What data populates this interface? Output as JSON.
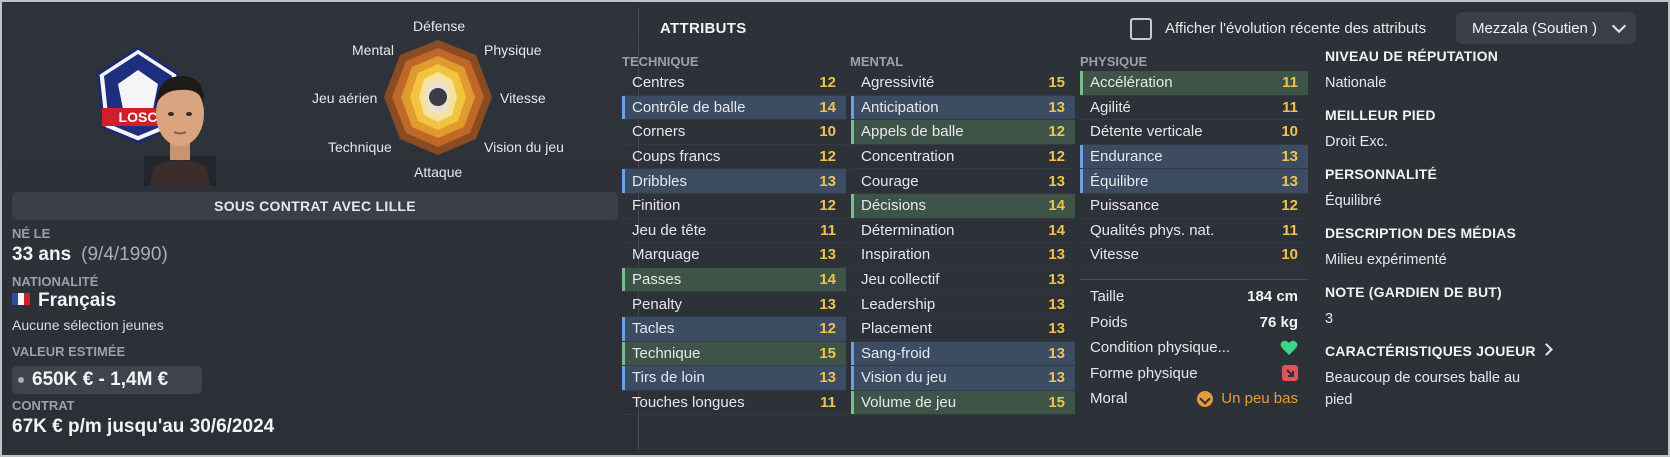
{
  "radar": {
    "labels": {
      "top": "Défense",
      "top_right": "Physique",
      "right": "Vitesse",
      "bottom_right": "Vision du jeu",
      "bottom": "Attaque",
      "bottom_left": "Technique",
      "left": "Jeu aérien",
      "top_left": "Mental"
    }
  },
  "club_logo": {
    "text": "LOSC"
  },
  "contract_banner": "SOUS CONTRAT AVEC LILLE",
  "born": {
    "label": "NÉ LE",
    "age": "33 ans",
    "date": "(9/4/1990)"
  },
  "nationality": {
    "label": "NATIONALITÉ",
    "value": "Français",
    "note": "Aucune sélection jeunes"
  },
  "estimated_value": {
    "label": "VALEUR ESTIMÉE",
    "value": "650K € - 1,4M €"
  },
  "contract": {
    "label": "CONTRAT",
    "value": "67K € p/m jusqu'au 30/6/2024"
  },
  "attributes": {
    "title": "ATTRIBUTS",
    "checkbox_label": "Afficher l'évolution récente des attributs",
    "role": "Mezzala (Soutien )",
    "technique_header": "TECHNIQUE",
    "mental_header": "MENTAL",
    "physique_header": "PHYSIQUE",
    "technique": [
      {
        "name": "Centres",
        "value": "12",
        "hl": ""
      },
      {
        "name": "Contrôle de balle",
        "value": "14",
        "hl": "blue"
      },
      {
        "name": "Corners",
        "value": "10",
        "hl": ""
      },
      {
        "name": "Coups francs",
        "value": "12",
        "hl": ""
      },
      {
        "name": "Dribbles",
        "value": "13",
        "hl": "blue"
      },
      {
        "name": "Finition",
        "value": "12",
        "hl": ""
      },
      {
        "name": "Jeu de tête",
        "value": "11",
        "hl": ""
      },
      {
        "name": "Marquage",
        "value": "13",
        "hl": ""
      },
      {
        "name": "Passes",
        "value": "14",
        "hl": "green"
      },
      {
        "name": "Penalty",
        "value": "13",
        "hl": ""
      },
      {
        "name": "Tacles",
        "value": "12",
        "hl": "blue"
      },
      {
        "name": "Technique",
        "value": "15",
        "hl": "green"
      },
      {
        "name": "Tirs de loin",
        "value": "13",
        "hl": "blue"
      },
      {
        "name": "Touches longues",
        "value": "11",
        "hl": ""
      }
    ],
    "mental": [
      {
        "name": "Agressivité",
        "value": "15",
        "hl": ""
      },
      {
        "name": "Anticipation",
        "value": "13",
        "hl": "blue"
      },
      {
        "name": "Appels de balle",
        "value": "12",
        "hl": "green"
      },
      {
        "name": "Concentration",
        "value": "12",
        "hl": ""
      },
      {
        "name": "Courage",
        "value": "13",
        "hl": ""
      },
      {
        "name": "Décisions",
        "value": "14",
        "hl": "green"
      },
      {
        "name": "Détermination",
        "value": "14",
        "hl": ""
      },
      {
        "name": "Inspiration",
        "value": "13",
        "hl": ""
      },
      {
        "name": "Jeu collectif",
        "value": "13",
        "hl": ""
      },
      {
        "name": "Leadership",
        "value": "13",
        "hl": ""
      },
      {
        "name": "Placement",
        "value": "13",
        "hl": ""
      },
      {
        "name": "Sang-froid",
        "value": "13",
        "hl": "blue"
      },
      {
        "name": "Vision du jeu",
        "value": "13",
        "hl": "blue"
      },
      {
        "name": "Volume de jeu",
        "value": "15",
        "hl": "green"
      }
    ],
    "physique": [
      {
        "name": "Accélération",
        "value": "11",
        "hl": "green"
      },
      {
        "name": "Agilité",
        "value": "11",
        "hl": ""
      },
      {
        "name": "Détente verticale",
        "value": "10",
        "hl": ""
      },
      {
        "name": "Endurance",
        "value": "13",
        "hl": "blue"
      },
      {
        "name": "Équilibre",
        "value": "13",
        "hl": "blue"
      },
      {
        "name": "Puissance",
        "value": "12",
        "hl": ""
      },
      {
        "name": "Qualités phys. nat.",
        "value": "11",
        "hl": ""
      },
      {
        "name": "Vitesse",
        "value": "10",
        "hl": ""
      }
    ],
    "physical_info": {
      "height_label": "Taille",
      "height": "184 cm",
      "weight_label": "Poids",
      "weight": "76 kg",
      "condition_label": "Condition physique...",
      "form_label": "Forme physique",
      "morale_label": "Moral",
      "morale": "Un peu bas"
    }
  },
  "profile": {
    "reputation_label": "NIVEAU DE RÉPUTATION",
    "reputation": "Nationale",
    "foot_label": "MEILLEUR PIED",
    "foot": "Droit Exc.",
    "personality_label": "PERSONNALITÉ",
    "personality": "Équilibré",
    "media_label": "DESCRIPTION DES MÉDIAS",
    "media": "Milieu expérimenté",
    "gk_label": "NOTE (GARDIEN DE BUT)",
    "gk": "3",
    "traits_label": "CARACTÉRISTIQUES JOUEUR",
    "traits": "Beaucoup de courses balle au pied"
  },
  "colors": {
    "attr_value": "#f0c34a",
    "blue_highlight": "#3b4c63",
    "green_highlight": "#3f5448",
    "morale": "#e79a3b"
  }
}
